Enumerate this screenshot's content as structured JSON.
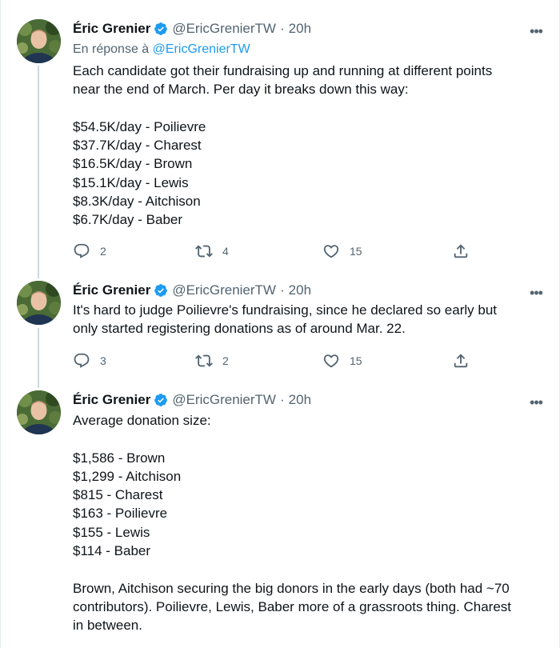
{
  "author": {
    "name": "Éric Grenier",
    "handle": "@EricGrenierTW",
    "dot": "·"
  },
  "tweets": [
    {
      "time": "20h",
      "reply_prefix": "En réponse à",
      "reply_handle": "@EricGrenierTW",
      "lines": [
        "Each candidate got their fundraising up and running at different points",
        "near the end of March. Per day it breaks down this way:",
        "",
        "$54.5K/day - Poilievre",
        "$37.7K/day - Charest",
        "$16.5K/day - Brown",
        "$15.1K/day - Lewis",
        "$8.3K/day - Aitchison",
        "$6.7K/day - Baber"
      ],
      "replies": "2",
      "retweets": "4",
      "likes": "15"
    },
    {
      "time": "20h",
      "lines": [
        "It's hard to judge Poilievre's fundraising, since he declared so early but",
        "only started registering donations as of around Mar. 22."
      ],
      "replies": "3",
      "retweets": "2",
      "likes": "15"
    },
    {
      "time": "20h",
      "lines": [
        "Average donation size:",
        "",
        "$1,586 - Brown",
        "$1,299 - Aitchison",
        "$815 - Charest",
        "$163 - Poilievre",
        "$155 - Lewis",
        "$114 - Baber",
        "",
        "Brown, Aitchison securing the big donors in the early days (both had ~70",
        "contributors). Poilievre, Lewis, Baber more of a grassroots thing. Charest",
        "in between."
      ]
    }
  ],
  "icons": {
    "reply": "reply-icon",
    "retweet": "retweet-icon",
    "like": "heart-icon",
    "share": "share-icon",
    "verified": "verified-badge-icon",
    "more": "more-icon"
  },
  "colors": {
    "accent": "#1d9bf0",
    "secondary_text": "#536471",
    "primary_text": "#0f1419",
    "thread_line": "#cfd9de"
  }
}
